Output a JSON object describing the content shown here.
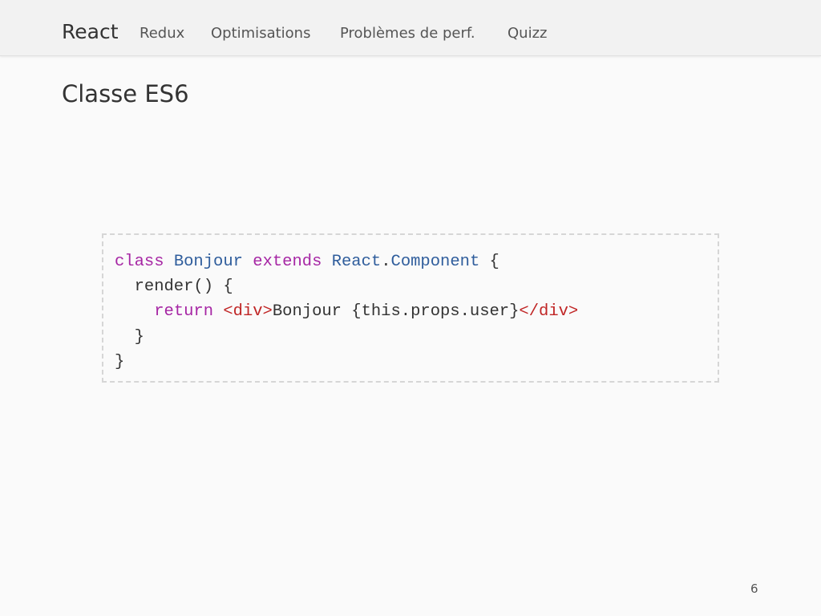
{
  "navbar": {
    "brand": "React",
    "items": [
      {
        "label": "Redux"
      },
      {
        "label": "Optimisations"
      },
      {
        "label": "Problèmes de perf."
      },
      {
        "label": "Quizz"
      }
    ]
  },
  "slide": {
    "title": "Classe ES6",
    "page_number": "6"
  },
  "code": {
    "line1": {
      "kw_class": "class",
      "sp1": " ",
      "name": "Bonjour",
      "sp2": " ",
      "kw_extends": "extends",
      "sp3": " ",
      "parent": "React",
      "dot": ".",
      "component": "Component",
      "brace": " {"
    },
    "line2": "  render() {",
    "line3": {
      "indent": "    ",
      "kw_return": "return",
      "sp": " ",
      "open_tag": "<div>",
      "text": "Bonjour {this.props.user}",
      "close_tag": "</div>"
    },
    "line4": "  }",
    "line5": "}"
  },
  "colors": {
    "keyword": "#a626a4",
    "class_name": "#2f5d9c",
    "jsx_tag": "#c02525",
    "background": "#fafafa",
    "navbar_bg": "#f2f2f2"
  }
}
